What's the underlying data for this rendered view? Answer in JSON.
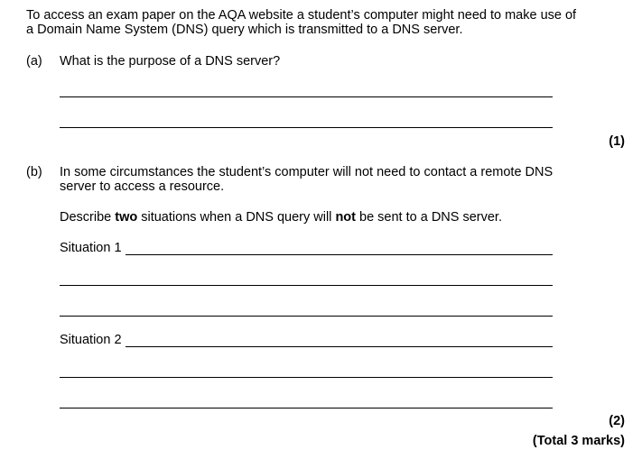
{
  "intro": {
    "line1": "To access an exam paper on the AQA website a student’s computer might need to make use of",
    "line2": "a Domain Name System (DNS) query which is transmitted to a DNS server."
  },
  "part_a": {
    "label": "(a)",
    "question": "What is the purpose of a DNS server?",
    "marks": "(1)"
  },
  "part_b": {
    "label": "(b)",
    "question_line1": "In some circumstances the student’s computer will not need to contact a remote DNS",
    "question_line2": "server to access a resource.",
    "instruction_pre": "Describe ",
    "instruction_bold1": "two",
    "instruction_mid": " situations when a DNS query will ",
    "instruction_bold2": "not",
    "instruction_post": " be sent to a DNS server.",
    "situation1_label": "Situation 1",
    "situation2_label": "Situation 2",
    "marks": "(2)"
  },
  "total": "(Total 3 marks)"
}
